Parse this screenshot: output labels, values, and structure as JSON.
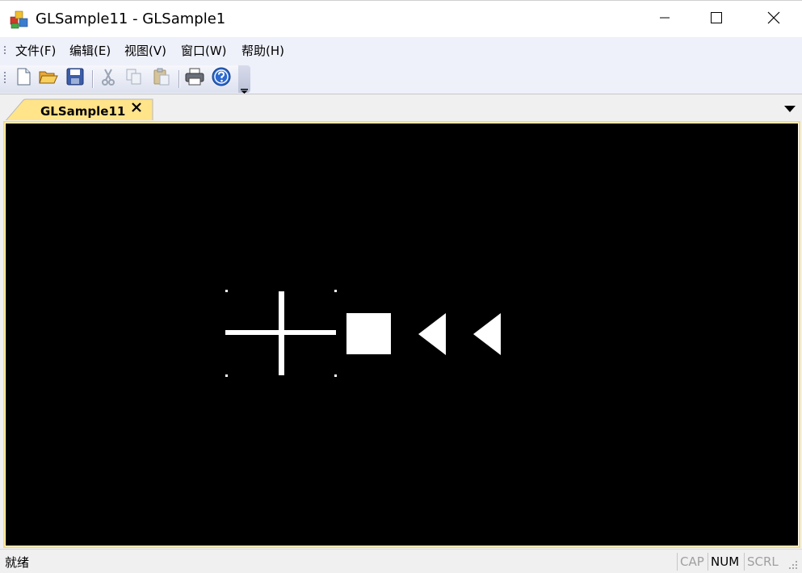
{
  "window": {
    "title": "GLSample11 - GLSample1",
    "icon": "mfc-app-icon",
    "controls": [
      "minimize-icon",
      "maximize-icon",
      "close-icon"
    ]
  },
  "menu": {
    "items": [
      {
        "label": "文件(F)"
      },
      {
        "label": "编辑(E)"
      },
      {
        "label": "视图(V)"
      },
      {
        "label": "窗口(W)"
      },
      {
        "label": "帮助(H)"
      }
    ]
  },
  "toolbar": {
    "buttons": [
      "new-document-icon",
      "open-folder-icon",
      "save-icon",
      "cut-icon",
      "copy-icon",
      "paste-icon",
      "print-icon",
      "help-icon"
    ],
    "overflow_icon": "toolbar-overflow-icon"
  },
  "tabs": {
    "items": [
      {
        "label": "GLSample11",
        "active": true,
        "accent": "#ffe48a"
      }
    ],
    "close_icon": "close-icon",
    "dropdown_icon": "chevron-down-icon"
  },
  "canvas": {
    "background": "#000000",
    "shape_color": "#ffffff",
    "shapes": [
      "crosshair",
      "square",
      "left-triangle",
      "left-triangle"
    ]
  },
  "status": {
    "text": "就绪",
    "indicators": [
      {
        "label": "CAP",
        "active": false
      },
      {
        "label": "NUM",
        "active": true
      },
      {
        "label": "SCRL",
        "active": false
      }
    ]
  }
}
